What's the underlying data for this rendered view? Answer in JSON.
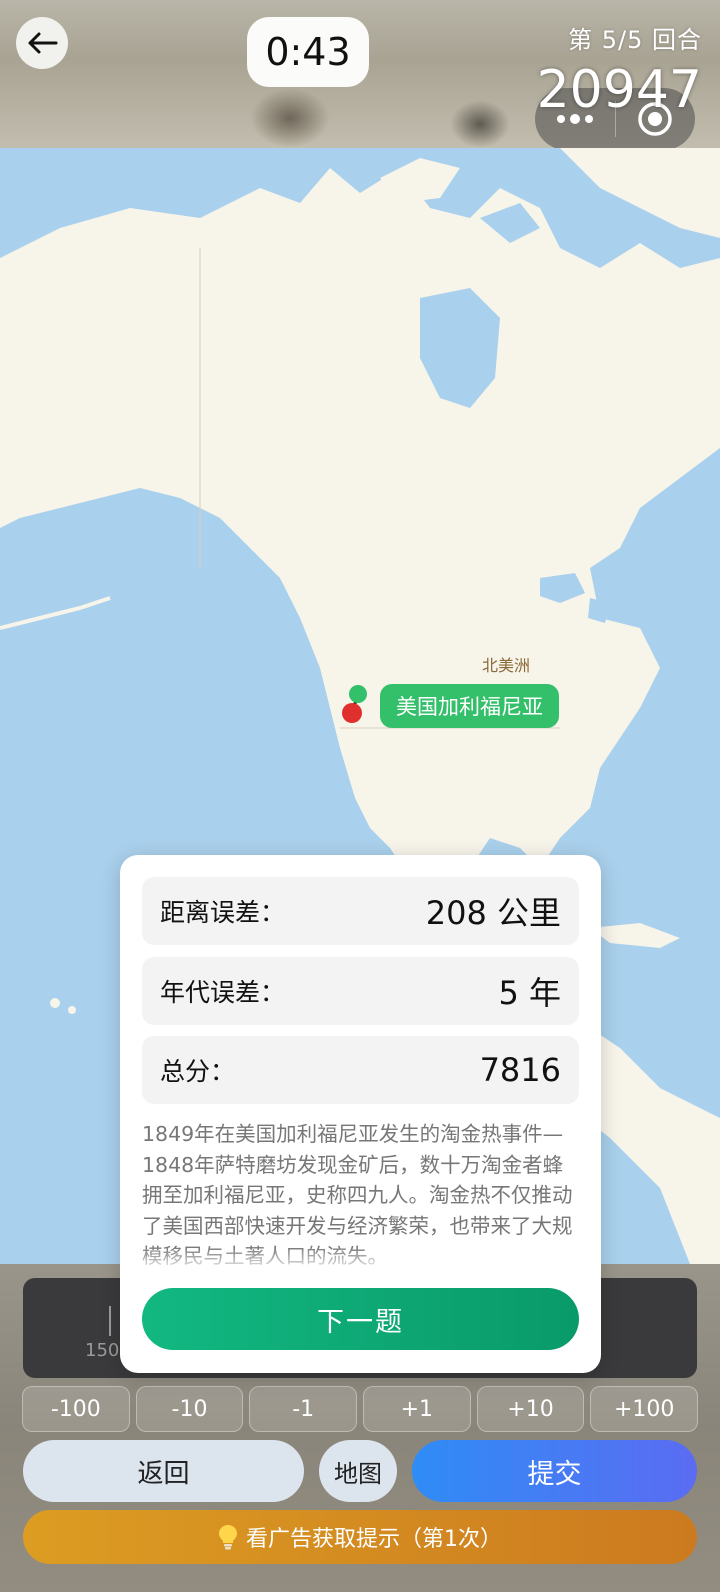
{
  "header": {
    "timer": "0:43",
    "round": "第 5/5 回合",
    "total_score": "20947"
  },
  "map": {
    "region_label": "北美洲",
    "answer_label": "美国加利福尼亚"
  },
  "result": {
    "distance_label": "距离误差：",
    "distance_value": "208 公里",
    "year_label": "年代误差：",
    "year_value": "5 年",
    "score_label": "总分：",
    "score_value": "7816",
    "description": "1849年在美国加利福尼亚发生的淘金热事件— 1848年萨特磨坊发现金矿后，数十万淘金者蜂拥至加利福尼亚，史称四九人。淘金热不仅推动了美国西部快速开发与经济繁荣，也带来了大规模移民与土著人口的流失。",
    "next_label": "下一题"
  },
  "controls": {
    "slider_tick_label": "150",
    "adjust": [
      "-100",
      "-10",
      "-1",
      "+1",
      "+10",
      "+100"
    ],
    "return_label": "返回",
    "map_label": "地图",
    "submit_label": "提交",
    "hint_label": "看广告获取提示（第1次）"
  },
  "colors": {
    "ocean": "#a9d0ec",
    "land": "#f7f4ea",
    "answer_pin": "#34c06a",
    "guess_pin": "#e0302e",
    "next_button": "#0fa975",
    "submit_button": "#3b82f6",
    "hint_button": "#d98e21"
  }
}
